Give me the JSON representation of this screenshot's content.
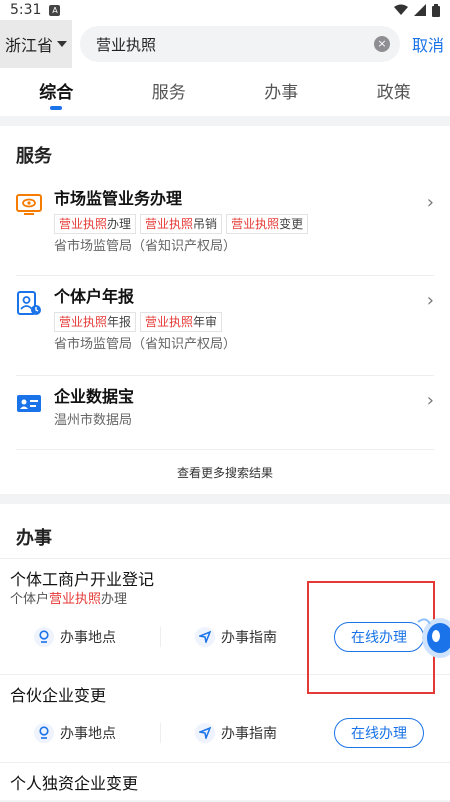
{
  "status": {
    "time": "5:31",
    "notif": "A"
  },
  "header": {
    "province": "浙江省",
    "search_value": "营业执照",
    "cancel": "取消"
  },
  "tabs": [
    {
      "label": "综合",
      "active": true
    },
    {
      "label": "服务",
      "active": false
    },
    {
      "label": "办事",
      "active": false
    },
    {
      "label": "政策",
      "active": false
    }
  ],
  "services": {
    "title": "服务",
    "items": [
      {
        "name": "市场监管业务办理",
        "icon": "monitor-eye-icon",
        "tags": [
          {
            "hl": "营业执照",
            "rest": "办理"
          },
          {
            "hl": "营业执照",
            "rest": "吊销"
          },
          {
            "hl": "营业执照",
            "rest": "变更"
          }
        ],
        "dept": "省市场监管局（省知识产权局）"
      },
      {
        "name": "个体户年报",
        "icon": "person-document-icon",
        "tags": [
          {
            "hl": "营业执照",
            "rest": "年报"
          },
          {
            "hl": "营业执照",
            "rest": "年审"
          }
        ],
        "dept": "省市场监管局（省知识产权局）"
      },
      {
        "name": "企业数据宝",
        "icon": "id-card-icon",
        "tags": [],
        "dept": "温州市数据局"
      }
    ],
    "more": "查看更多搜索结果"
  },
  "affairs": {
    "title": "办事",
    "items": [
      {
        "name": "个体工商户开业登记",
        "sub_pre": "个体户",
        "sub_hl": "营业执照",
        "sub_post": "办理",
        "place": "办事地点",
        "guide": "办事指南",
        "online": "在线办理"
      },
      {
        "name": "合伙企业变更",
        "place": "办事地点",
        "guide": "办事指南",
        "online": "在线办理"
      },
      {
        "name": "个人独资企业变更"
      }
    ]
  },
  "colors": {
    "accent": "#1a73e8",
    "highlight": "#e53935",
    "icon_orange": "#f57c00"
  }
}
